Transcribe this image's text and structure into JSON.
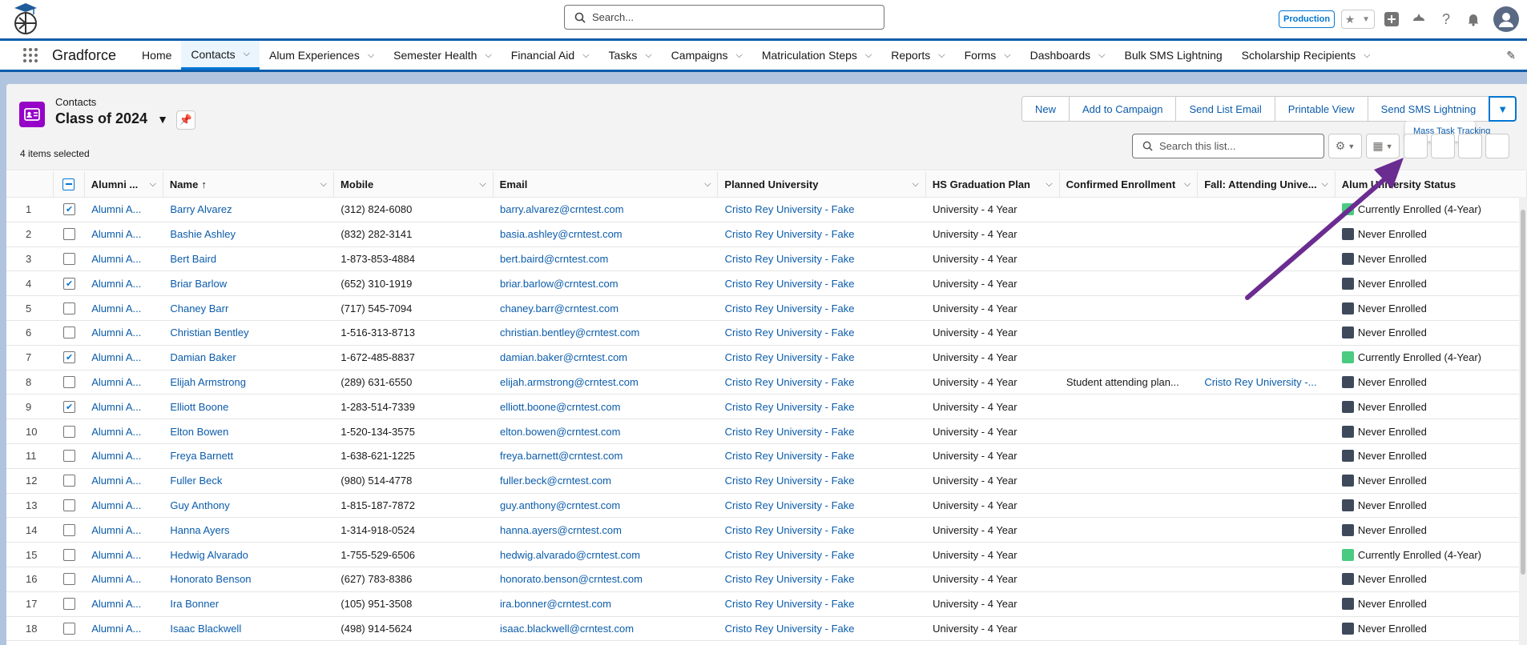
{
  "header": {
    "search_placeholder": "Search...",
    "environment_badge": "Production",
    "icons": [
      "favorites-star-icon",
      "add-icon",
      "trailhead-icon",
      "help-icon",
      "notifications-bell-icon",
      "user-avatar-icon"
    ]
  },
  "nav": {
    "app_name": "Gradforce",
    "items": [
      {
        "label": "Home",
        "dropdown": false
      },
      {
        "label": "Contacts",
        "dropdown": true,
        "active": true
      },
      {
        "label": "Alum Experiences",
        "dropdown": true
      },
      {
        "label": "Semester Health",
        "dropdown": true
      },
      {
        "label": "Financial Aid",
        "dropdown": true
      },
      {
        "label": "Tasks",
        "dropdown": true
      },
      {
        "label": "Campaigns",
        "dropdown": true
      },
      {
        "label": "Matriculation Steps",
        "dropdown": true
      },
      {
        "label": "Reports",
        "dropdown": true
      },
      {
        "label": "Forms",
        "dropdown": true
      },
      {
        "label": "Dashboards",
        "dropdown": true
      },
      {
        "label": "Bulk SMS Lightning",
        "dropdown": false
      },
      {
        "label": "Scholarship Recipients",
        "dropdown": true
      }
    ]
  },
  "list_view": {
    "object_name": "Contacts",
    "title": "Class of 2024",
    "selected_text": "4 items selected",
    "buttons": [
      "New",
      "Add to Campaign",
      "Send List Email",
      "Printable View",
      "Send SMS Lightning"
    ],
    "more_menu_item": "Mass Task Tracking",
    "search_placeholder": "Search this list..."
  },
  "table": {
    "columns": [
      "Alumni ...",
      "Name",
      "Mobile",
      "Email",
      "Planned University",
      "HS Graduation Plan",
      "Confirmed Enrollment",
      "Fall: Attending Unive...",
      "Alum University Status"
    ],
    "rows": [
      {
        "n": "1",
        "checked": true,
        "alumni": "Alumni A...",
        "name": "Barry Alvarez",
        "mobile": "(312) 824-6080",
        "email": "barry.alvarez@crntest.com",
        "planned": "Cristo Rey University - Fake",
        "plan": "University - 4 Year",
        "confirmed": "",
        "fall": "",
        "status": "Currently Enrolled (4-Year)",
        "status_color": "#4bca81"
      },
      {
        "n": "2",
        "checked": false,
        "alumni": "Alumni A...",
        "name": "Bashie Ashley",
        "mobile": "(832) 282-3141",
        "email": "basia.ashley@crntest.com",
        "planned": "Cristo Rey University - Fake",
        "plan": "University - 4 Year",
        "confirmed": "",
        "fall": "",
        "status": "Never Enrolled",
        "status_color": "#3e4a5b"
      },
      {
        "n": "3",
        "checked": false,
        "alumni": "Alumni A...",
        "name": "Bert Baird",
        "mobile": "1-873-853-4884",
        "email": "bert.baird@crntest.com",
        "planned": "Cristo Rey University - Fake",
        "plan": "University - 4 Year",
        "confirmed": "",
        "fall": "",
        "status": "Never Enrolled",
        "status_color": "#3e4a5b"
      },
      {
        "n": "4",
        "checked": true,
        "alumni": "Alumni A...",
        "name": "Briar Barlow",
        "mobile": "(652) 310-1919",
        "email": "briar.barlow@crntest.com",
        "planned": "Cristo Rey University - Fake",
        "plan": "University - 4 Year",
        "confirmed": "",
        "fall": "",
        "status": "Never Enrolled",
        "status_color": "#3e4a5b"
      },
      {
        "n": "5",
        "checked": false,
        "alumni": "Alumni A...",
        "name": "Chaney Barr",
        "mobile": "(717) 545-7094",
        "email": "chaney.barr@crntest.com",
        "planned": "Cristo Rey University - Fake",
        "plan": "University - 4 Year",
        "confirmed": "",
        "fall": "",
        "status": "Never Enrolled",
        "status_color": "#3e4a5b"
      },
      {
        "n": "6",
        "checked": false,
        "alumni": "Alumni A...",
        "name": "Christian Bentley",
        "mobile": "1-516-313-8713",
        "email": "christian.bentley@crntest.com",
        "planned": "Cristo Rey University - Fake",
        "plan": "University - 4 Year",
        "confirmed": "",
        "fall": "",
        "status": "Never Enrolled",
        "status_color": "#3e4a5b"
      },
      {
        "n": "7",
        "checked": true,
        "alumni": "Alumni A...",
        "name": "Damian Baker",
        "mobile": "1-672-485-8837",
        "email": "damian.baker@crntest.com",
        "planned": "Cristo Rey University - Fake",
        "plan": "University - 4 Year",
        "confirmed": "",
        "fall": "",
        "status": "Currently Enrolled (4-Year)",
        "status_color": "#4bca81"
      },
      {
        "n": "8",
        "checked": false,
        "alumni": "Alumni A...",
        "name": "Elijah Armstrong",
        "mobile": "(289) 631-6550",
        "email": "elijah.armstrong@crntest.com",
        "planned": "Cristo Rey University - Fake",
        "plan": "University - 4 Year",
        "confirmed": "Student attending plan...",
        "fall": "Cristo Rey University -...",
        "status": "Never Enrolled",
        "status_color": "#3e4a5b"
      },
      {
        "n": "9",
        "checked": true,
        "alumni": "Alumni A...",
        "name": "Elliott Boone",
        "mobile": "1-283-514-7339",
        "email": "elliott.boone@crntest.com",
        "planned": "Cristo Rey University - Fake",
        "plan": "University - 4 Year",
        "confirmed": "",
        "fall": "",
        "status": "Never Enrolled",
        "status_color": "#3e4a5b"
      },
      {
        "n": "10",
        "checked": false,
        "alumni": "Alumni A...",
        "name": "Elton Bowen",
        "mobile": "1-520-134-3575",
        "email": "elton.bowen@crntest.com",
        "planned": "Cristo Rey University - Fake",
        "plan": "University - 4 Year",
        "confirmed": "",
        "fall": "",
        "status": "Never Enrolled",
        "status_color": "#3e4a5b"
      },
      {
        "n": "11",
        "checked": false,
        "alumni": "Alumni A...",
        "name": "Freya Barnett",
        "mobile": "1-638-621-1225",
        "email": "freya.barnett@crntest.com",
        "planned": "Cristo Rey University - Fake",
        "plan": "University - 4 Year",
        "confirmed": "",
        "fall": "",
        "status": "Never Enrolled",
        "status_color": "#3e4a5b"
      },
      {
        "n": "12",
        "checked": false,
        "alumni": "Alumni A...",
        "name": "Fuller Beck",
        "mobile": "(980) 514-4778",
        "email": "fuller.beck@crntest.com",
        "planned": "Cristo Rey University - Fake",
        "plan": "University - 4 Year",
        "confirmed": "",
        "fall": "",
        "status": "Never Enrolled",
        "status_color": "#3e4a5b"
      },
      {
        "n": "13",
        "checked": false,
        "alumni": "Alumni A...",
        "name": "Guy Anthony",
        "mobile": "1-815-187-7872",
        "email": "guy.anthony@crntest.com",
        "planned": "Cristo Rey University - Fake",
        "plan": "University - 4 Year",
        "confirmed": "",
        "fall": "",
        "status": "Never Enrolled",
        "status_color": "#3e4a5b"
      },
      {
        "n": "14",
        "checked": false,
        "alumni": "Alumni A...",
        "name": "Hanna Ayers",
        "mobile": "1-314-918-0524",
        "email": "hanna.ayers@crntest.com",
        "planned": "Cristo Rey University - Fake",
        "plan": "University - 4 Year",
        "confirmed": "",
        "fall": "",
        "status": "Never Enrolled",
        "status_color": "#3e4a5b"
      },
      {
        "n": "15",
        "checked": false,
        "alumni": "Alumni A...",
        "name": "Hedwig Alvarado",
        "mobile": "1-755-529-6506",
        "email": "hedwig.alvarado@crntest.com",
        "planned": "Cristo Rey University - Fake",
        "plan": "University - 4 Year",
        "confirmed": "",
        "fall": "",
        "status": "Currently Enrolled (4-Year)",
        "status_color": "#4bca81"
      },
      {
        "n": "16",
        "checked": false,
        "alumni": "Alumni A...",
        "name": "Honorato Benson",
        "mobile": "(627) 783-8386",
        "email": "honorato.benson@crntest.com",
        "planned": "Cristo Rey University - Fake",
        "plan": "University - 4 Year",
        "confirmed": "",
        "fall": "",
        "status": "Never Enrolled",
        "status_color": "#3e4a5b"
      },
      {
        "n": "17",
        "checked": false,
        "alumni": "Alumni A...",
        "name": "Ira Bonner",
        "mobile": "(105) 951-3508",
        "email": "ira.bonner@crntest.com",
        "planned": "Cristo Rey University - Fake",
        "plan": "University - 4 Year",
        "confirmed": "",
        "fall": "",
        "status": "Never Enrolled",
        "status_color": "#3e4a5b"
      },
      {
        "n": "18",
        "checked": false,
        "alumni": "Alumni A...",
        "name": "Isaac Blackwell",
        "mobile": "(498) 914-5624",
        "email": "isaac.blackwell@crntest.com",
        "planned": "Cristo Rey University - Fake",
        "plan": "University - 4 Year",
        "confirmed": "",
        "fall": "",
        "status": "Never Enrolled",
        "status_color": "#3e4a5b"
      }
    ]
  },
  "colors": {
    "brand_blue": "#0176d3",
    "link_blue": "#0b5cab",
    "object_icon": "#9602c7",
    "annotation_arrow": "#6b2c91"
  }
}
